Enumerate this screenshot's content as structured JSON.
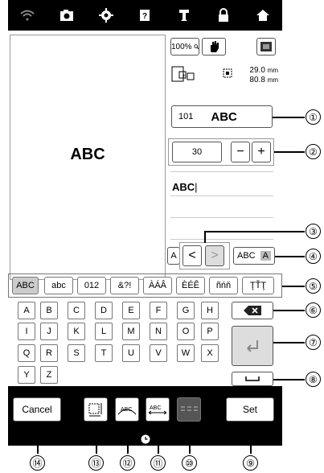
{
  "top_icons": [
    "wifi-icon",
    "camera-icon",
    "gear-icon",
    "help-icon",
    "machine-icon",
    "lock-icon",
    "home-icon"
  ],
  "preview": {
    "text": "ABC"
  },
  "toolbar": {
    "zoom": "100%",
    "size_w": "29.0",
    "size_h": "80.8",
    "unit": "mm"
  },
  "font": {
    "number": "101",
    "sample": "ABC"
  },
  "size": {
    "value": "30",
    "minus": "−",
    "plus": "+"
  },
  "input": {
    "text": "ABC"
  },
  "cursor": {
    "prev": "<",
    "next": ">",
    "left_mode": "A",
    "right_mode": "A",
    "mode_text": "ABC"
  },
  "tabs": [
    "ABC",
    "abc",
    "012",
    "&?!",
    "ÀÁÂ",
    "ÈÉÊ",
    "ñńň",
    "ŢŤŢ"
  ],
  "keys": {
    "row1": [
      "A",
      "B",
      "C",
      "D",
      "E",
      "F",
      "G",
      "H"
    ],
    "row2": [
      "I",
      "J",
      "K",
      "L",
      "M",
      "N",
      "O",
      "P"
    ],
    "row3": [
      "Q",
      "R",
      "S",
      "T",
      "U",
      "V",
      "W",
      "X"
    ],
    "row4": [
      "Y",
      "Z"
    ]
  },
  "buttons": {
    "cancel": "Cancel",
    "set": "Set"
  },
  "callouts": [
    "①",
    "②",
    "③",
    "④",
    "⑤",
    "⑥",
    "⑦",
    "⑧",
    "⑨",
    "⑩",
    "⑪",
    "⑫",
    "⑬",
    "⑭"
  ]
}
